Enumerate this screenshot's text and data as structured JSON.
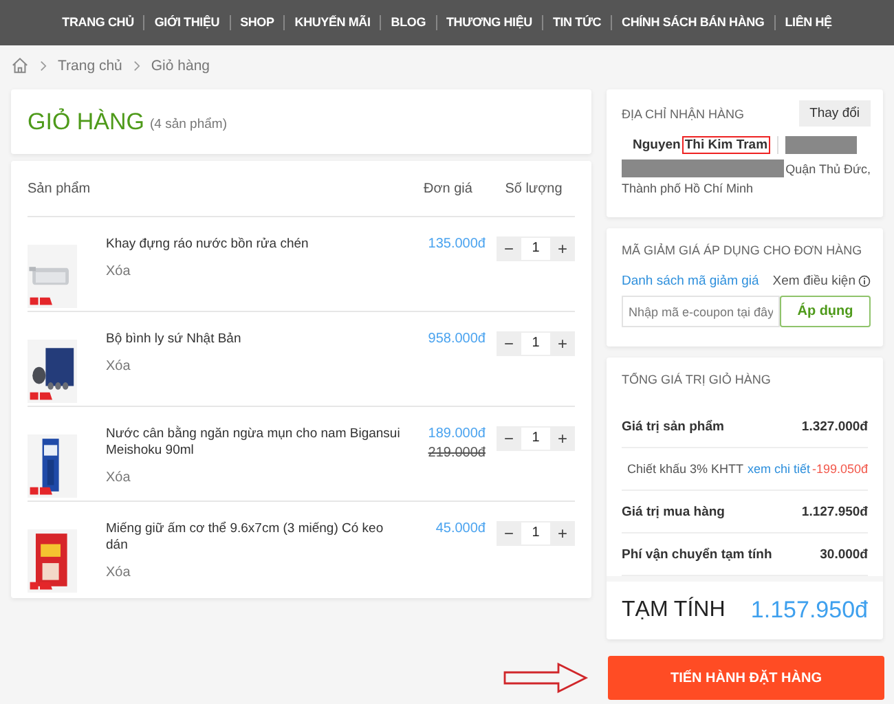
{
  "nav": {
    "items": [
      "TRANG CHỦ",
      "GIỚI THIỆU",
      "SHOP",
      "KHUYẾN MÃI",
      "BLOG",
      "THƯƠNG HIỆU",
      "TIN TỨC",
      "CHÍNH SÁCH BÁN HÀNG",
      "LIÊN HỆ"
    ]
  },
  "breadcrumb": [
    "Trang chủ",
    "Giỏ hàng"
  ],
  "cart": {
    "title": "GIỎ HÀNG",
    "count": "(4 sản phẩm)",
    "columns": [
      "Sản phẩm",
      "Đơn giá",
      "Số lượng"
    ],
    "items": [
      {
        "name": "Khay đựng ráo nước bồn rửa chén",
        "remove": "Xóa",
        "price": "135.000đ",
        "quantity": "1",
        "decrement": "−",
        "increment": "+"
      },
      {
        "name": "Bộ bình ly sứ Nhật Bản",
        "remove": "Xóa",
        "price": "958.000đ",
        "quantity": "1",
        "decrement": "−",
        "increment": "+"
      },
      {
        "name": "Nước cân bằng ngăn ngừa mụn cho nam Bigansui Meishoku 90ml",
        "remove": "Xóa",
        "price": "189.000đ",
        "old_price": "219.000đ",
        "quantity": "1",
        "decrement": "−",
        "increment": "+"
      },
      {
        "name": "Miếng giữ ấm cơ thể 9.6x7cm (3 miếng) Có keo dán",
        "remove": "Xóa",
        "price": "45.000đ",
        "quantity": "1",
        "decrement": "−",
        "increment": "+"
      }
    ]
  },
  "address": {
    "title": "ĐỊA CHỈ NHẬN HÀNG",
    "change_button": "Thay đổi",
    "name_first": "Nguyen",
    "name_highlighted": "Thi Kim Tram",
    "district": "Quận Thủ Đức,",
    "city": "Thành phố Hồ Chí Minh"
  },
  "coupon": {
    "title": "MÃ GIẢM GIÁ ÁP DỤNG CHO ĐƠN HÀNG",
    "list_link": "Danh sách mã giảm giá",
    "conditions_link": "Xem điều kiện",
    "placeholder": "Nhập mã e-coupon tại đây",
    "apply_button": "Áp dụng"
  },
  "summary": {
    "title": "TỔNG GIÁ TRỊ GIỎ HÀNG",
    "rows": [
      {
        "kind": "line",
        "label": "Giá trị sản phẩm",
        "value": "1.327.000đ"
      },
      {
        "kind": "discount",
        "label": "Chiết khấu 3% KHTT",
        "link": "xem chi tiết",
        "value": "-199.050đ"
      },
      {
        "kind": "line",
        "label": "Giá trị mua hàng",
        "value": "1.127.950đ"
      },
      {
        "kind": "line",
        "label": "Phí vận chuyển tạm tính",
        "value": "30.000đ"
      }
    ],
    "total_label": "TẠM TÍNH",
    "total_value": "1.157.950đ"
  },
  "checkout_button": "TIẾN HÀNH ĐẶT HÀNG"
}
